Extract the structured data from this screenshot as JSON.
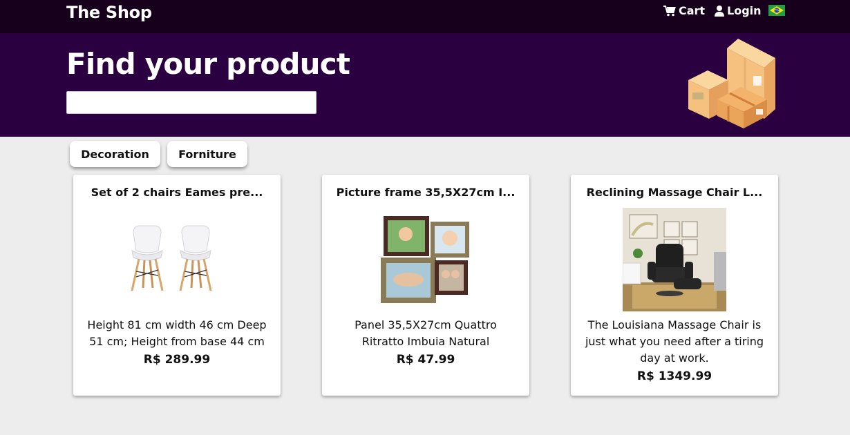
{
  "header": {
    "brand": "The Shop",
    "cart_label": "Cart",
    "login_label": "Login",
    "flag": "brazil-flag"
  },
  "hero": {
    "title": "Find your product",
    "search_value": "",
    "search_placeholder": ""
  },
  "categories": [
    {
      "label": "Decoration"
    },
    {
      "label": "Forniture"
    }
  ],
  "products": [
    {
      "title": "Set of 2 chairs Eames pre...",
      "description": "Height 81 cm width 46 cm Deep 51 cm; Height from base 44 cm",
      "price": "R$ 289.99"
    },
    {
      "title": "Picture frame 35,5X27cm I...",
      "description": "Panel 35,5X27cm Quattro Ritratto Imbuia Natural",
      "price": "R$ 47.99"
    },
    {
      "title": "Reclining Massage Chair L...",
      "description": "The Louisiana Massage Chair is just what you need after a tiring day at work.",
      "price": "R$ 1349.99"
    }
  ],
  "colors": {
    "topbar": "#16001b",
    "hero": "#2a0040",
    "page_bg": "#ededed"
  }
}
